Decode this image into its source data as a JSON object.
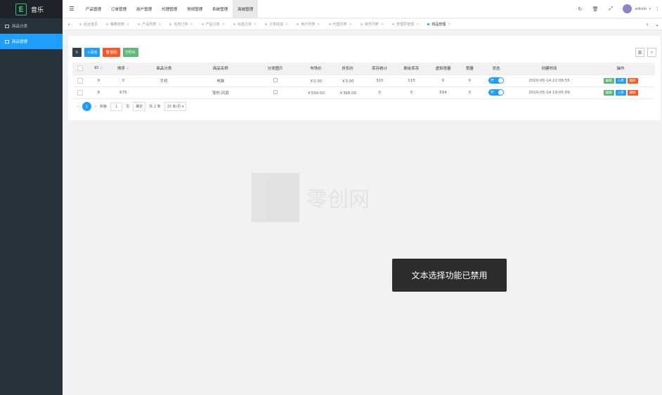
{
  "app": {
    "logo_letter": "E",
    "name": "音乐"
  },
  "sidebar": {
    "items": [
      {
        "label": "商品分类",
        "active": false
      },
      {
        "label": "商品管理",
        "active": true
      }
    ]
  },
  "header": {
    "nav": [
      "产品管理",
      "订单管理",
      "用户管理",
      "代理管理",
      "常规管理",
      "系统管理",
      "商城管理"
    ],
    "active_nav": "商城管理",
    "user": "admin"
  },
  "tabs": {
    "items": [
      "后台首页",
      "策略定制",
      "产品列表",
      "任务订单",
      "产品订单",
      "充值订单",
      "订单收益",
      "用户列表",
      "代理列表",
      "城市列表",
      "管理员管理",
      "商品管理"
    ],
    "active": "商品管理"
  },
  "toolbar": {
    "add": "添加",
    "delete": "删除",
    "export": "导出"
  },
  "table": {
    "headers": [
      "ID",
      "排序",
      "商品分类",
      "商品名称",
      "分类图片",
      "市场价",
      "折扣价",
      "库存统计",
      "剩余库存",
      "虚拟销量",
      "销量",
      "状态",
      "创建时间",
      "操作"
    ],
    "rows": [
      [
        "9",
        "0",
        "手机",
        "电脑",
        "",
        "￥0.00",
        "￥0.00",
        "320",
        "115",
        "0",
        "0",
        "开",
        "2020-05-14 22:06:55"
      ],
      [
        "8",
        "675",
        "",
        "落地-风扇",
        "",
        "￥599.00",
        "￥368.00",
        "0",
        "0",
        "594",
        "0",
        "开",
        "2020-05-14 19:05:09"
      ]
    ],
    "ops": [
      "编辑",
      "入库",
      "删除"
    ]
  },
  "pager": {
    "current": "1",
    "goto_label": "到第",
    "goto_value": "1",
    "page_unit": "页",
    "confirm": "确定",
    "total": "共 2 条",
    "per_page": "15 条/页"
  },
  "watermark": "零创网",
  "toast": "文本选择功能已禁用"
}
